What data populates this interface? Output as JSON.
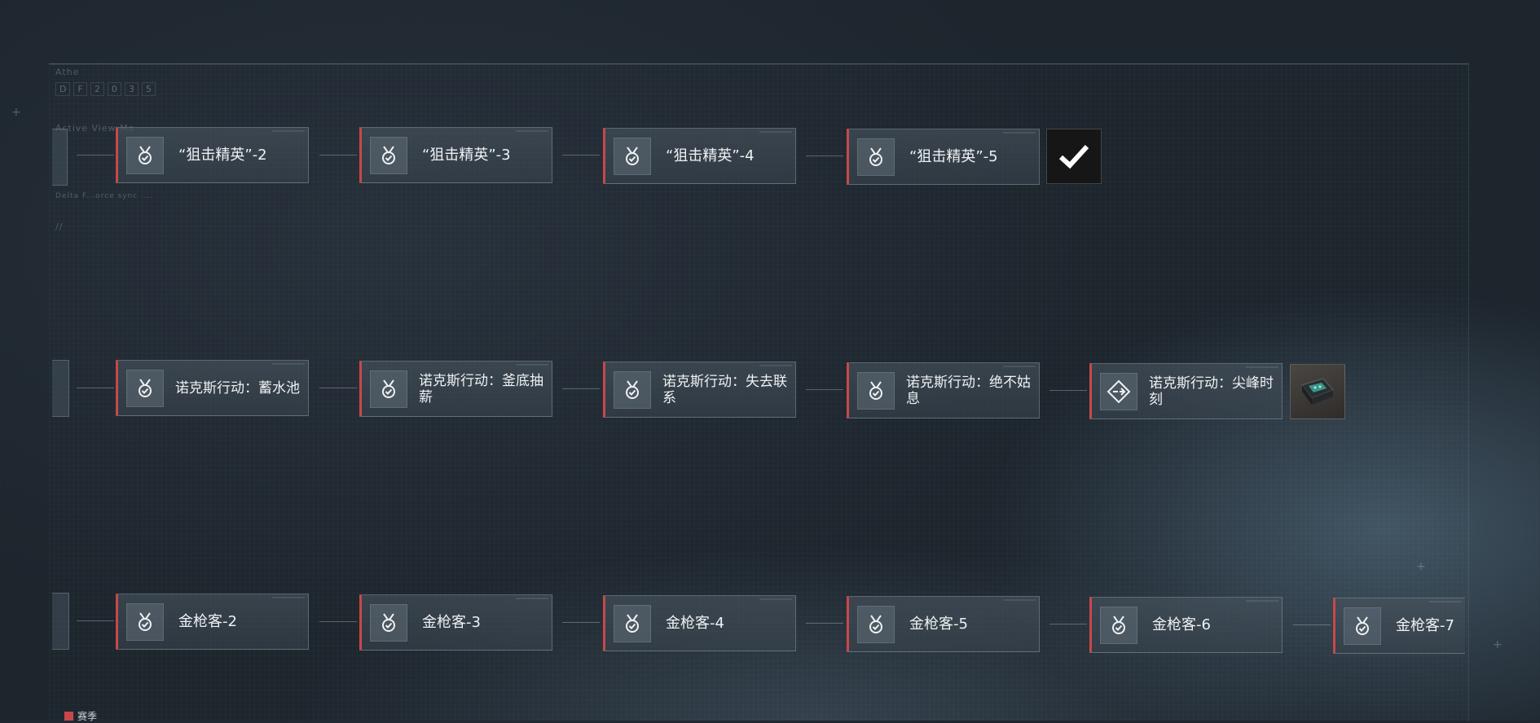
{
  "hud": {
    "ghost_title": "",
    "corner_label": "Athe",
    "code_cells": [
      "D",
      "F",
      "2",
      "0",
      "3",
      "5"
    ],
    "view_label": "Active View Mo",
    "sync_label": "Delta F...orce sync ....",
    "slash": "//"
  },
  "rows": [
    {
      "cards": [
        {
          "label": "“狙击精英”-2",
          "icon": "medal-icon"
        },
        {
          "label": "“狙击精英”-3",
          "icon": "medal-icon"
        },
        {
          "label": "“狙击精英”-4",
          "icon": "medal-icon"
        },
        {
          "label": "“狙击精英”-5",
          "icon": "medal-icon"
        }
      ],
      "reward": "checkmark-icon"
    },
    {
      "cards": [
        {
          "label": "诺克斯行动：蓄水池",
          "icon": "medal-icon"
        },
        {
          "label": "诺克斯行动：釜底抽薪",
          "icon": "medal-icon"
        },
        {
          "label": "诺克斯行动：失去联系",
          "icon": "medal-icon"
        },
        {
          "label": "诺克斯行动：绝不姑息",
          "icon": "medal-icon"
        },
        {
          "label": "诺克斯行动：尖峰时刻",
          "icon": "diamond-arrow-icon"
        }
      ],
      "reward": "device-chip-icon"
    },
    {
      "cards": [
        {
          "label": "金枪客-2",
          "icon": "medal-icon"
        },
        {
          "label": "金枪客-3",
          "icon": "medal-icon"
        },
        {
          "label": "金枪客-4",
          "icon": "medal-icon"
        },
        {
          "label": "金枪客-5",
          "icon": "medal-icon"
        },
        {
          "label": "金枪客-6",
          "icon": "medal-icon"
        },
        {
          "label": "金枪客-7",
          "icon": "medal-icon"
        }
      ]
    }
  ],
  "legend": {
    "label": "赛季",
    "color": "#c8484a"
  },
  "colors": {
    "accent": "#c8484a",
    "card_border": "#9fb0bd"
  }
}
